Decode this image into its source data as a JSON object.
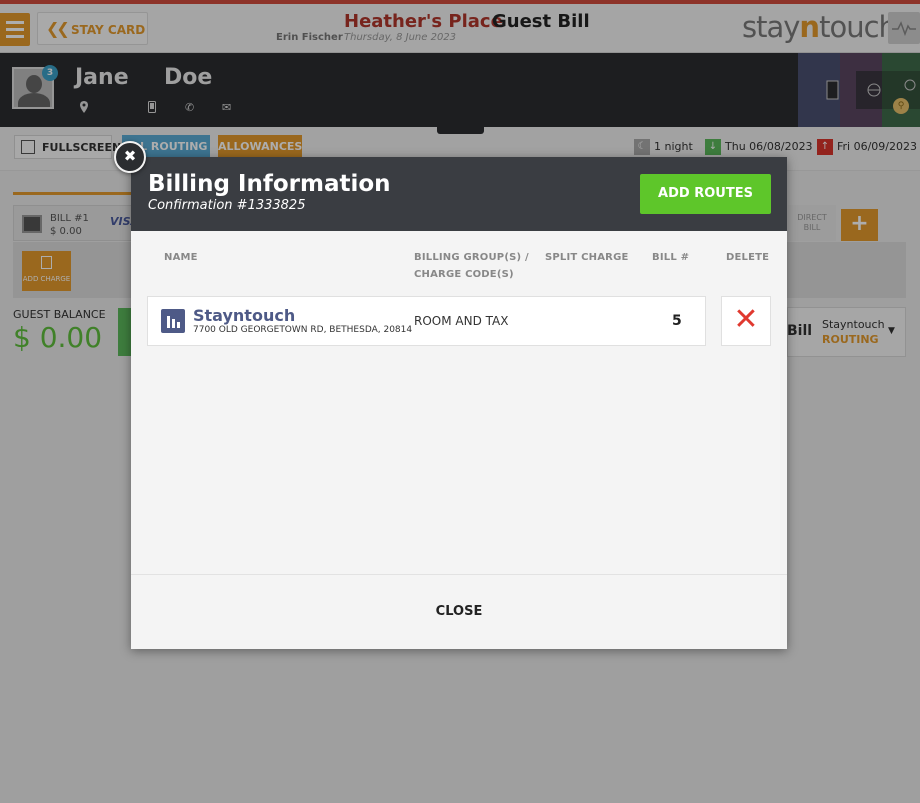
{
  "header": {
    "stay_card_label": "STAY CARD",
    "hotel_name": "Heather's Place",
    "page_title": "Guest Bill",
    "user_name": "Erin Fischer",
    "business_date": "Thursday, 8 June 2023",
    "logo_left": "stay",
    "logo_mid": "n",
    "logo_right": "touch"
  },
  "guest": {
    "first_name": "Jane",
    "last_name": "Doe",
    "avatar_badge": "3"
  },
  "toolbar": {
    "fullscreen_label": "FULLSCREEN",
    "routing_label": "ALL ROUTING",
    "allowances_label": "ALLOWANCES",
    "nights": "1 night",
    "arrival": "Thu 06/08/2023",
    "departure": "Fri 06/09/2023"
  },
  "background": {
    "bill_label": "BILL #1",
    "bill_amount": "$ 0.00",
    "visa": "VISA",
    "add_charge": "ADD CHARGE",
    "guest_balance_label": "GUEST BALANCE",
    "guest_balance": "$ 0.00",
    "direct_bill": "DIRECT BILL",
    "bill_short": "Bill",
    "dropdown_name": "Stayntouch",
    "dropdown_sub": "ROUTING"
  },
  "modal": {
    "title": "Billing Information",
    "subtitle": "Confirmation #1333825",
    "add_routes_label": "ADD ROUTES",
    "columns": {
      "name": "NAME",
      "billing_group": "BILLING GROUP(S) /",
      "billing_group_2": "CHARGE CODE(S)",
      "split_charge": "SPLIT CHARGE",
      "bill_num": "BILL #",
      "delete": "DELETE"
    },
    "routes": [
      {
        "name": "Stayntouch",
        "address": "7700 OLD GEORGETOWN RD, BETHESDA, 20814",
        "billing_group": "ROOM AND TAX",
        "bill_number": "5"
      }
    ],
    "close_label": "CLOSE"
  },
  "colors": {
    "accent_orange": "#e39a2d",
    "add_routes_green": "#5ec62a",
    "header_dark": "#3a3d42",
    "route_blue": "#4e5a87",
    "delete_red": "#e0392f"
  }
}
